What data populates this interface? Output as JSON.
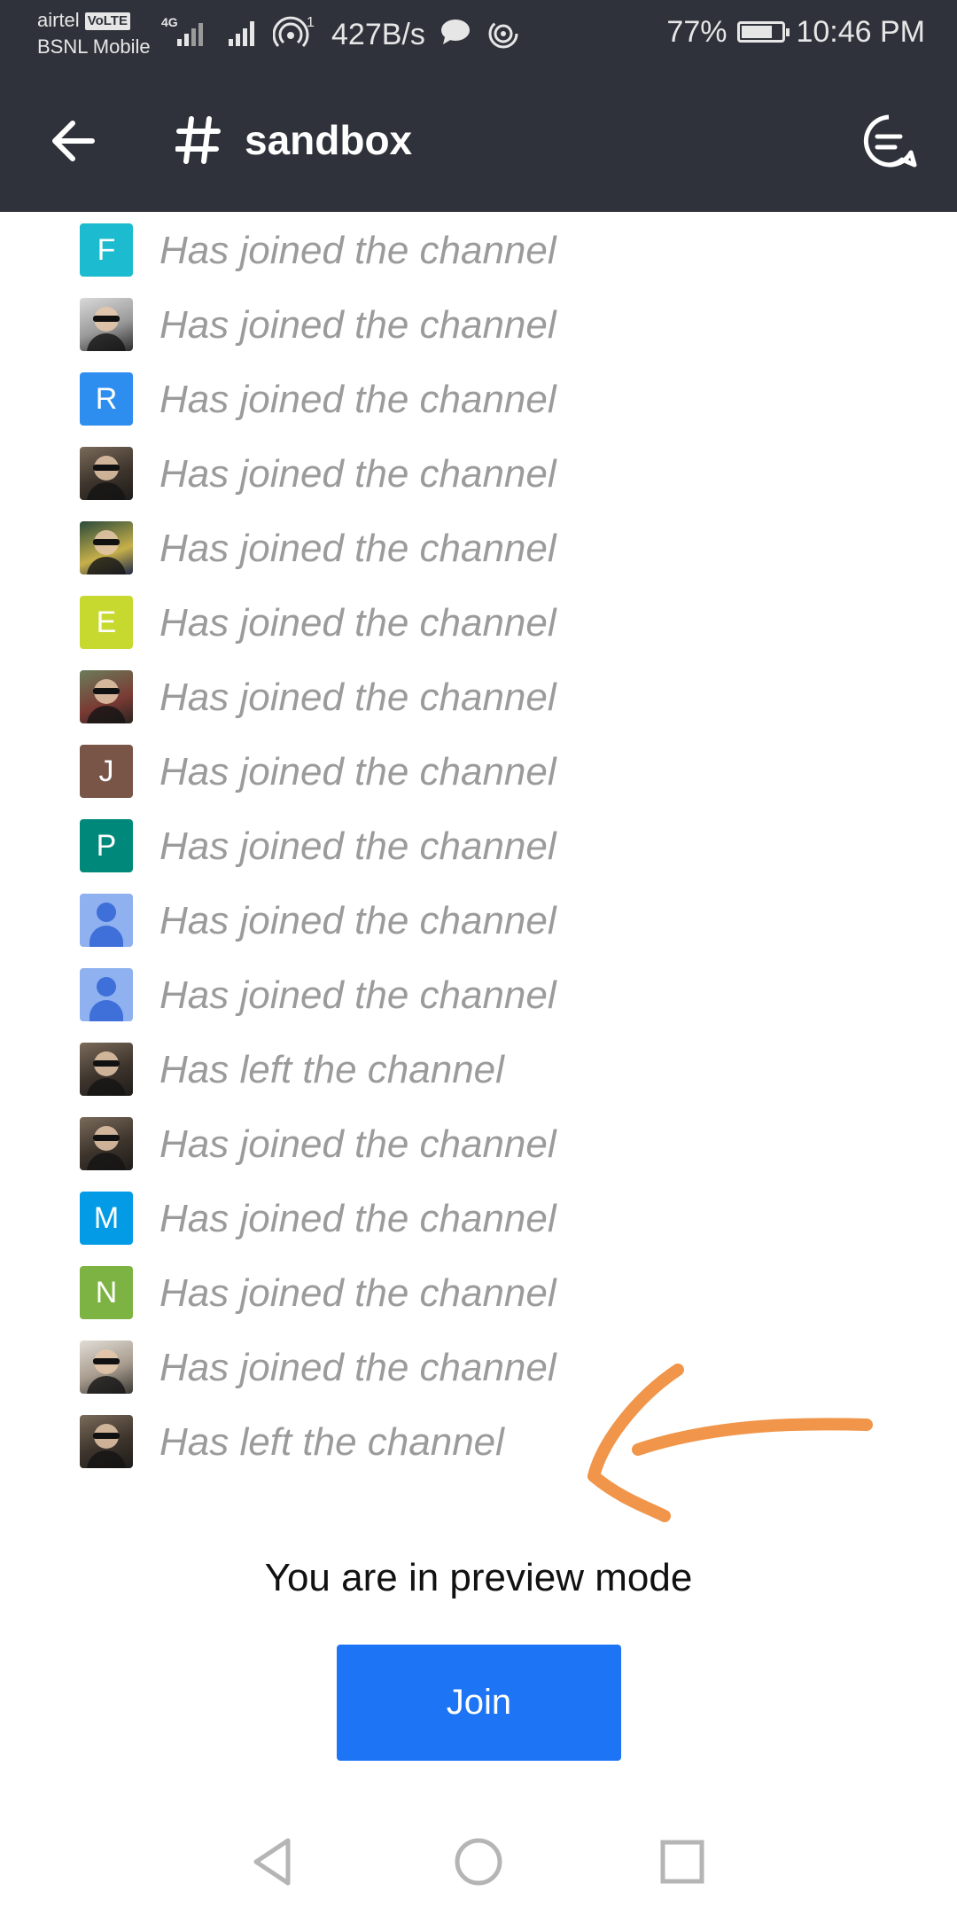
{
  "status_bar": {
    "carrier1": "airtel",
    "volte": "VoLTE",
    "carrier2": "BSNL Mobile",
    "network_type": "4G",
    "hotspot_count": "1",
    "speed": "427B/s",
    "battery": "77%",
    "time": "10:46 PM"
  },
  "app_bar": {
    "back_icon": "arrow-left-icon",
    "channel_icon": "hash-icon",
    "channel_name": "sandbox",
    "threads_icon": "threads-icon"
  },
  "messages": [
    {
      "avatar_type": "letter",
      "letter": "F",
      "color": "#1cbbcf",
      "text": "Has joined the channel"
    },
    {
      "avatar_type": "photo",
      "style": "photo2",
      "text": "Has joined the channel"
    },
    {
      "avatar_type": "letter",
      "letter": "R",
      "color": "#2d8ef0",
      "text": "Has joined the channel"
    },
    {
      "avatar_type": "photo",
      "style": "photo",
      "text": "Has joined the channel"
    },
    {
      "avatar_type": "photo",
      "style": "photo3",
      "text": "Has joined the channel"
    },
    {
      "avatar_type": "letter",
      "letter": "E",
      "color": "#c7d92f",
      "text": "Has joined the channel"
    },
    {
      "avatar_type": "photo",
      "style": "photo4",
      "text": "Has joined the channel"
    },
    {
      "avatar_type": "letter",
      "letter": "J",
      "color": "#795548",
      "text": "Has joined the channel"
    },
    {
      "avatar_type": "letter",
      "letter": "P",
      "color": "#00897b",
      "text": "Has joined the channel"
    },
    {
      "avatar_type": "user",
      "text": "Has joined the channel"
    },
    {
      "avatar_type": "user",
      "text": "Has joined the channel"
    },
    {
      "avatar_type": "photo",
      "style": "photo",
      "text": "Has left the channel"
    },
    {
      "avatar_type": "photo",
      "style": "photo",
      "text": "Has joined the channel"
    },
    {
      "avatar_type": "letter",
      "letter": "M",
      "color": "#039be5",
      "text": "Has joined the channel"
    },
    {
      "avatar_type": "letter",
      "letter": "N",
      "color": "#7cb342",
      "text": "Has joined the channel"
    },
    {
      "avatar_type": "photo",
      "style": "photo5",
      "text": "Has joined the channel"
    },
    {
      "avatar_type": "photo",
      "style": "photo",
      "text": "Has left the channel"
    }
  ],
  "annotation": {
    "icon": "hand-drawn-arrow-icon",
    "color": "#f0954a"
  },
  "preview": {
    "message": "You are in preview mode",
    "join_label": "Join",
    "join_color": "#1d74f5"
  },
  "nav": {
    "back": "triangle-back-icon",
    "home": "circle-home-icon",
    "recents": "square-recents-icon"
  }
}
